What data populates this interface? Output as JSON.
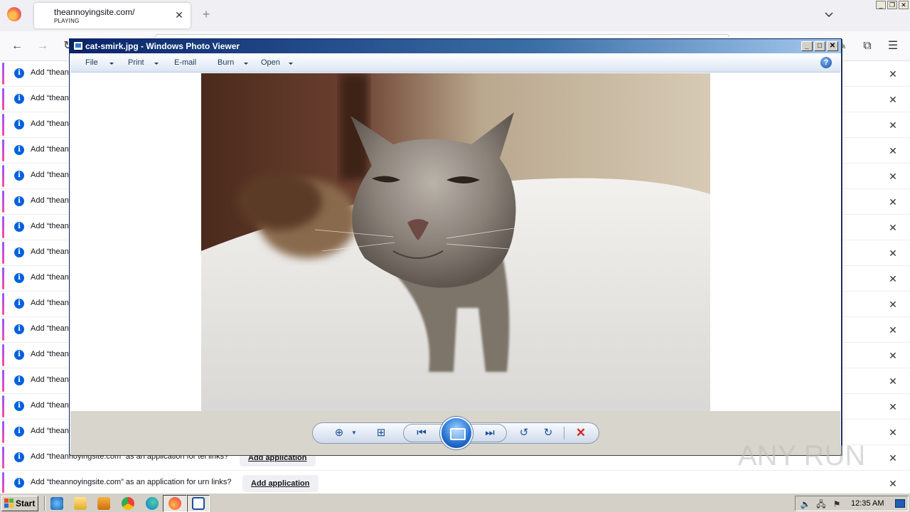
{
  "browser": {
    "tab": {
      "title": "theannoyingsite.com/",
      "status": "PLAYING"
    }
  },
  "notifications": {
    "message_short": "Add “thean",
    "count_short": 15,
    "tel": {
      "message": "Add “theannoyingsite.com” as an application for tel links?",
      "button": "Add application"
    },
    "urn": {
      "message": "Add “theannoyingsite.com” as an application for urn links?",
      "button": "Add application"
    }
  },
  "photo_viewer": {
    "title": "cat-smirk.jpg - Windows Photo Viewer",
    "menu": [
      "File",
      "Print",
      "E-mail",
      "Burn",
      "Open"
    ],
    "icons": [
      "zoom-icon",
      "actual-size-icon",
      "previous-icon",
      "slideshow-icon",
      "next-icon",
      "rotate-counterclockwise-icon",
      "rotate-clockwise-icon",
      "delete-icon"
    ]
  },
  "watermark": "ANY RUN",
  "taskbar": {
    "start": "Start",
    "clock": "12:35 AM"
  }
}
